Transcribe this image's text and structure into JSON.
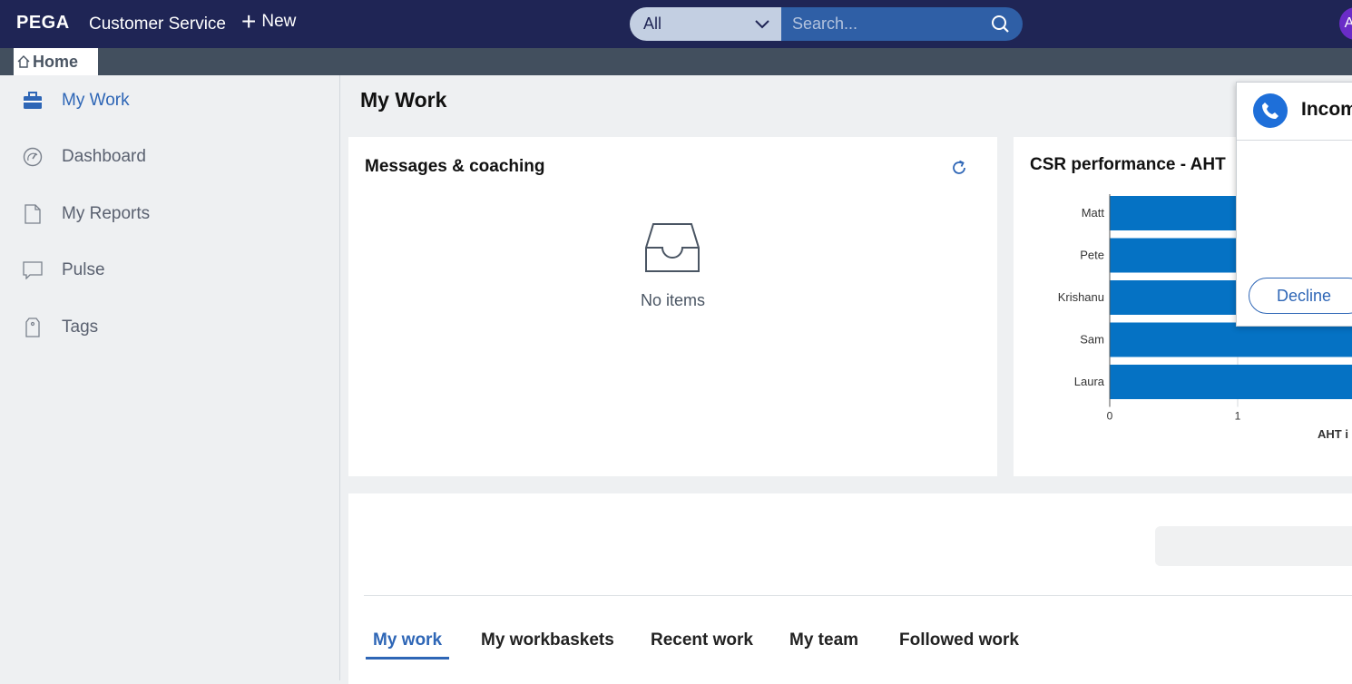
{
  "header": {
    "logo": "PEGA",
    "app_name": "Customer Service",
    "new_label": "New",
    "search_scope": "All",
    "search_placeholder": "Search...",
    "avatar_initial": "A"
  },
  "tabs": {
    "home_label": "Home"
  },
  "sidebar": {
    "items": [
      {
        "label": "My Work",
        "icon": "briefcase-icon",
        "active": true
      },
      {
        "label": "Dashboard",
        "icon": "gauge-icon",
        "active": false
      },
      {
        "label": "My Reports",
        "icon": "document-icon",
        "active": false
      },
      {
        "label": "Pulse",
        "icon": "chat-bubble-icon",
        "active": false
      },
      {
        "label": "Tags",
        "icon": "tag-icon",
        "active": false
      }
    ]
  },
  "main": {
    "page_title": "My Work",
    "messages": {
      "title": "Messages & coaching",
      "empty_text": "No items"
    },
    "performance": {
      "title": "CSR performance - AHT"
    },
    "work_tabs": [
      "My work",
      "My workbaskets",
      "Recent work",
      "My team",
      "Followed work"
    ]
  },
  "popup": {
    "title": "Incom",
    "decline_label": "Decline"
  },
  "colors": {
    "header_bg": "#1f2555",
    "accent": "#2e66b6",
    "bar": "#0572c4"
  },
  "chart_data": {
    "type": "bar",
    "orientation": "horizontal",
    "title": "CSR performance - AHT",
    "categories": [
      "Matt",
      "Pete",
      "Krishanu",
      "Sam",
      "Laura"
    ],
    "values": [
      2,
      2,
      2,
      2,
      2
    ],
    "xlabel": "AHT i",
    "ticks": [
      "0",
      "1"
    ],
    "grid": true
  }
}
